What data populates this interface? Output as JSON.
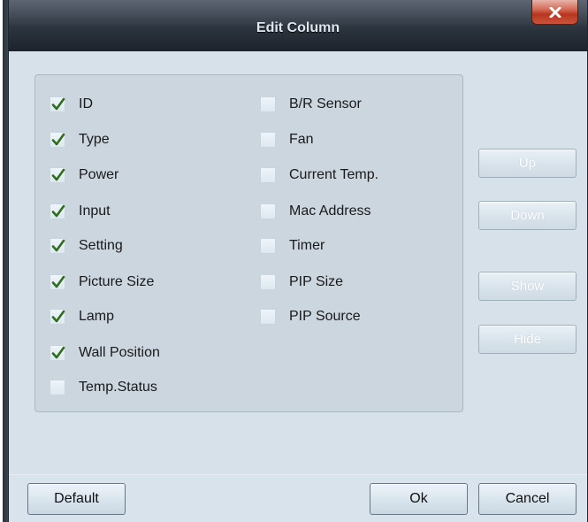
{
  "window": {
    "title": "Edit Column",
    "close_icon": "close-icon"
  },
  "columns_left": [
    {
      "label": "ID",
      "checked": true
    },
    {
      "label": "Type",
      "checked": true
    },
    {
      "label": "Power",
      "checked": true
    },
    {
      "label": "Input",
      "checked": true
    },
    {
      "label": "Setting",
      "checked": true
    },
    {
      "label": "Picture Size",
      "checked": true
    },
    {
      "label": "Lamp",
      "checked": true
    },
    {
      "label": "Wall Position",
      "checked": true
    },
    {
      "label": "Temp.Status",
      "checked": false
    }
  ],
  "columns_right": [
    {
      "label": "B/R Sensor",
      "checked": false
    },
    {
      "label": "Fan",
      "checked": false
    },
    {
      "label": "Current Temp.",
      "checked": false
    },
    {
      "label": "Mac Address",
      "checked": false
    },
    {
      "label": "Timer",
      "checked": false
    },
    {
      "label": "PIP Size",
      "checked": false
    },
    {
      "label": "PIP Source",
      "checked": false
    }
  ],
  "side_buttons": {
    "up": "Up",
    "down": "Down",
    "show": "Show",
    "hide": "Hide"
  },
  "footer": {
    "default": "Default",
    "ok": "Ok",
    "cancel": "Cancel"
  },
  "colors": {
    "check_mark": "#2f6e1e",
    "dialog_bg": "#d4e0e9",
    "titlebar": "#2a323c",
    "close_button": "#c9553c"
  }
}
